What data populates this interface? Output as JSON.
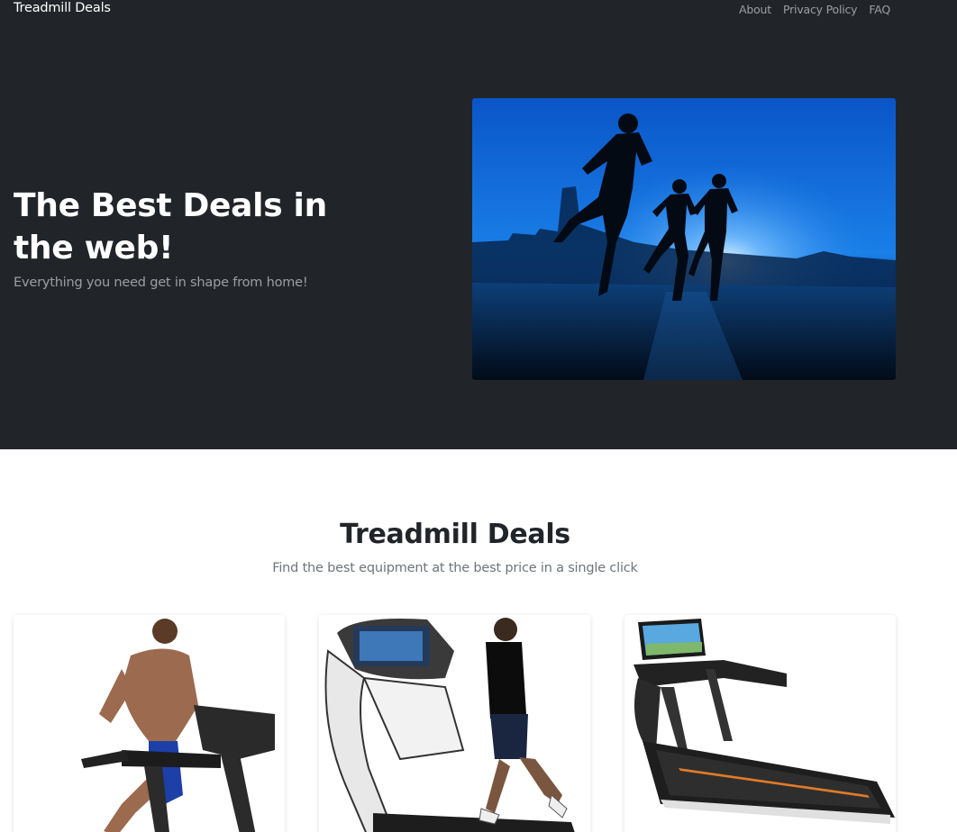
{
  "navbar": {
    "brand": "Treadmill Deals",
    "links": [
      "About",
      "Privacy Policy",
      "FAQ"
    ]
  },
  "hero": {
    "title": "The Best Deals in the web!",
    "subtitle": "Everything you need get in shape from home!"
  },
  "deals": {
    "title": "Treadmill Deals",
    "subtitle": "Find the best equipment at the best price in a single click"
  }
}
